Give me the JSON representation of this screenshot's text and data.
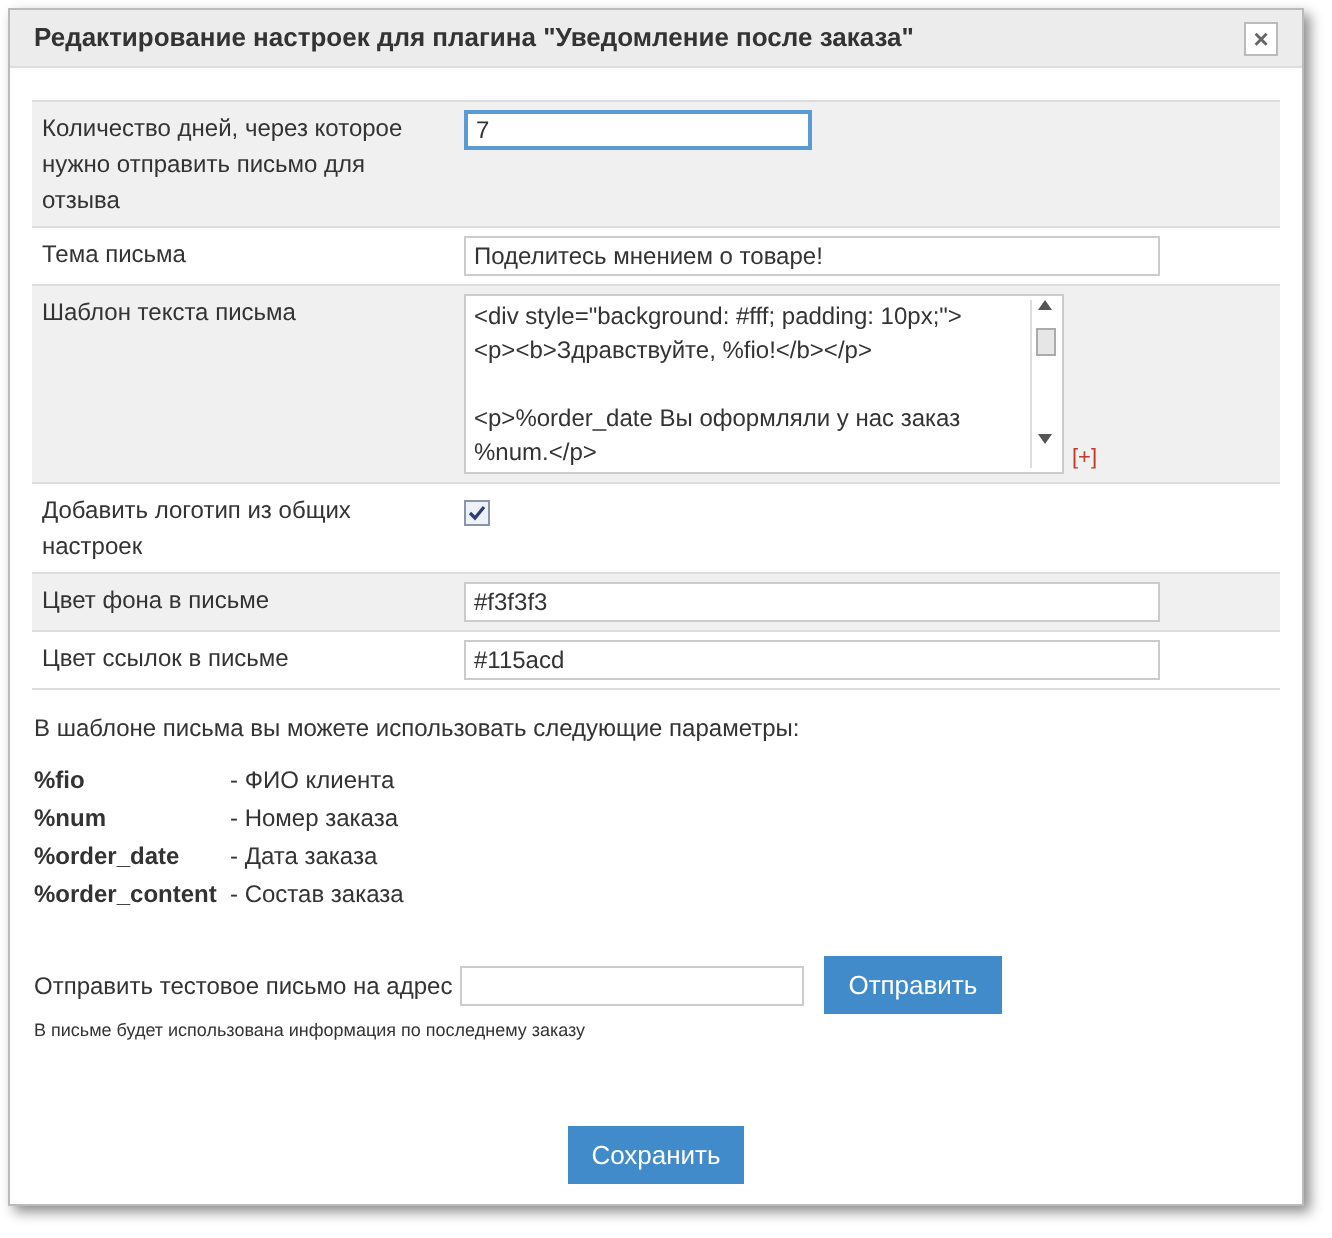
{
  "window": {
    "title": "Редактирование настроек для плагина \"Уведомление после заказа\"",
    "close": "×"
  },
  "settings": [
    {
      "kind": "text",
      "label": "Количество дней, через которое нужно отправить письмо для отзыва",
      "value": "7",
      "focused": true
    },
    {
      "kind": "text",
      "label": "Тема письма",
      "value": "Поделитесь мнением о товаре!",
      "focused": false
    },
    {
      "kind": "textarea",
      "label": "Шаблон текста письма",
      "value": "<div style=\"background: #fff; padding: 10px;\">\n<p><b>Здравствуйте, %fio!</b></p>\n\n<p>%order_date Вы оформляли у нас заказ %num.</p>",
      "expand": "[+]"
    },
    {
      "kind": "checkbox",
      "label": "Добавить логотип из общих настроек",
      "checked": true
    },
    {
      "kind": "text",
      "label": "Цвет фона в письме",
      "value": "#f3f3f3",
      "focused": false
    },
    {
      "kind": "text",
      "label": "Цвет ссылок в письме",
      "value": "#115acd",
      "focused": false
    }
  ],
  "params_intro": "В шаблоне письма вы можете использовать следующие параметры:",
  "params": [
    {
      "name": "%fio",
      "description": "- ФИО клиента"
    },
    {
      "name": "%num",
      "description": "- Номер заказа"
    },
    {
      "name": "%order_date",
      "description": "- Дата заказа"
    },
    {
      "name": "%order_content",
      "description": "- Состав заказа"
    }
  ],
  "test_email": {
    "label": "Отправить тестовое письмо на адрес",
    "button": "Отправить",
    "note": "В письме будет использована информация по последнему заказу"
  },
  "save_button": "Сохранить"
}
